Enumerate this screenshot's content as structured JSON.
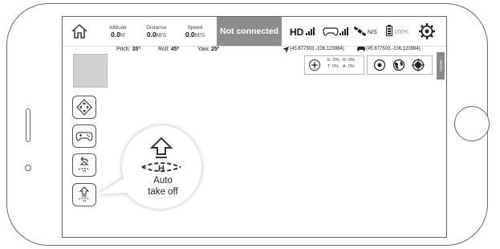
{
  "topbar": {
    "telemetry": [
      {
        "label": "Altitude",
        "value": "0.0",
        "unit": "M"
      },
      {
        "label": "Distance",
        "value": "0.0",
        "unit": "M/S"
      },
      {
        "label": "Speed",
        "value": "0.0",
        "unit": "M/S"
      }
    ],
    "connection_status": "Not connected",
    "video_label": "HD",
    "gps_label": "N/S",
    "battery_label": "100%"
  },
  "attitude": {
    "pitch_label": "Pitch:",
    "pitch_value": "35º",
    "roll_label": "Roll:",
    "roll_value": "45º",
    "yaw_label": "Yaw:",
    "yaw_value": "25º"
  },
  "coordinates": {
    "aircraft": "(45.877503,-106.123984)",
    "controller": "(45.877503,-106.123984)"
  },
  "stick_info": {
    "e": "E: 0%",
    "r": "R: 0%",
    "t": "T: 0%",
    "a": "A: 0%"
  },
  "side_tab_label": "MEDIA",
  "callout": {
    "line1": "Auto",
    "line2": "take off"
  },
  "icons": {
    "home": "home-icon",
    "settings": "gear-icon",
    "remote": "gamepad-icon",
    "satellite": "satellite-icon",
    "battery": "battery-icon"
  }
}
